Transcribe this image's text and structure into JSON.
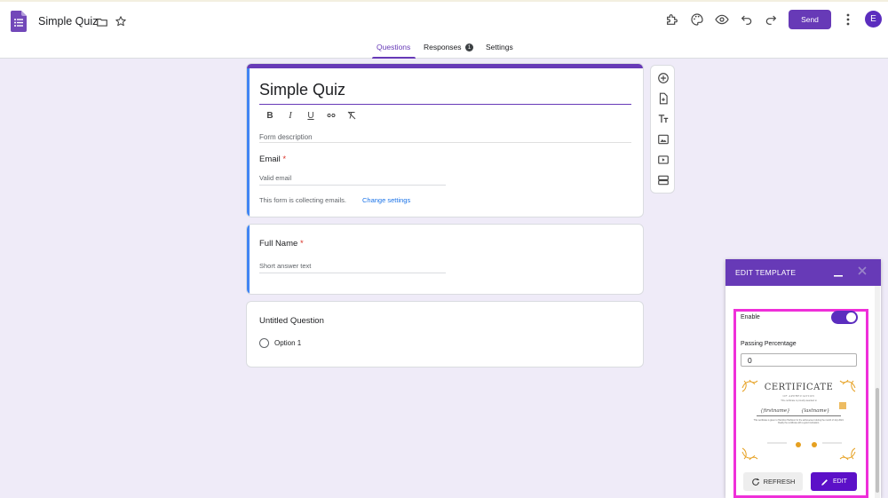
{
  "header": {
    "title": "Simple Quiz",
    "send_label": "Send",
    "avatar_letter": "E",
    "accent": "#673ab7"
  },
  "tabs": [
    {
      "label": "Questions"
    },
    {
      "label": "Responses",
      "badge": "1"
    },
    {
      "label": "Settings"
    }
  ],
  "form": {
    "title": "Simple Quiz",
    "description_placeholder": "Form description",
    "email_label": "Email",
    "email_placeholder": "Valid email",
    "collecting_note": "This form is collecting emails.",
    "change_settings_link": "Change settings",
    "required_marker": "*"
  },
  "questions": [
    {
      "label": "Full Name",
      "required": "*",
      "placeholder": "Short answer text"
    },
    {
      "label": "Untitled Question",
      "option": "Option 1"
    }
  ],
  "panel": {
    "title": "EDIT TEMPLATE",
    "enable_label": "Enable",
    "passing_label": "Passing Percentage",
    "passing_value": "0",
    "refresh_label": "REFRESH",
    "edit_label": "EDIT",
    "highlight_color": "#ef2fd9",
    "certificate": {
      "title": "CERTIFICATE",
      "subtitle": "OF APPRECIATION",
      "presented": "This certificate is proudly awarded to",
      "first_name": "{firstname}",
      "last_name": "{lastname}",
      "body": "This certificate is given to Hamilton Harbison for the achievement during the month of July 2024. Really the certificate with a good motivation."
    }
  }
}
